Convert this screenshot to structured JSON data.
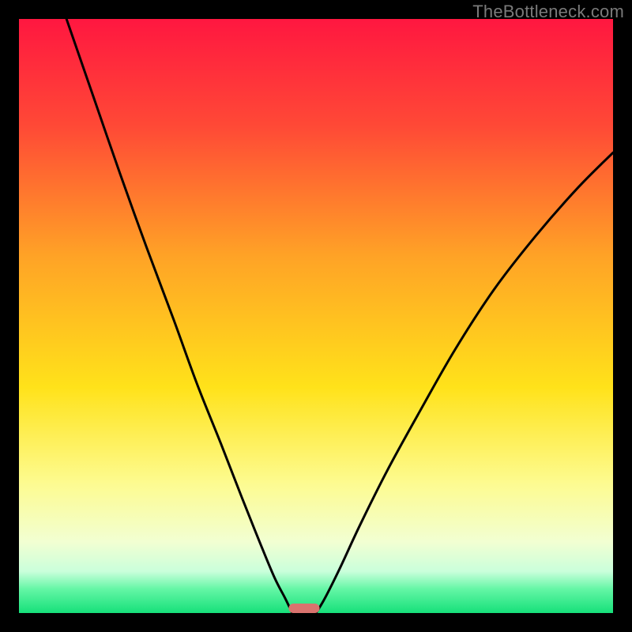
{
  "watermark": {
    "text": "TheBottleneck.com"
  },
  "chart_data": {
    "type": "line",
    "title": "",
    "xlabel": "",
    "ylabel": "",
    "xlim": [
      0,
      100
    ],
    "ylim": [
      0,
      100
    ],
    "grid": false,
    "legend": false,
    "background_gradient_stops": [
      {
        "offset": 0,
        "color": "#ff1740"
      },
      {
        "offset": 18,
        "color": "#ff4936"
      },
      {
        "offset": 40,
        "color": "#ffa326"
      },
      {
        "offset": 62,
        "color": "#ffe21a"
      },
      {
        "offset": 78,
        "color": "#fdfb8f"
      },
      {
        "offset": 88,
        "color": "#f2ffd2"
      },
      {
        "offset": 93,
        "color": "#caffdb"
      },
      {
        "offset": 96,
        "color": "#63f6a5"
      },
      {
        "offset": 100,
        "color": "#16e07a"
      }
    ],
    "series": [
      {
        "name": "left-branch",
        "x": [
          8.0,
          12.5,
          17.0,
          21.5,
          26.0,
          30.0,
          34.0,
          37.5,
          40.5,
          43.0,
          44.8,
          46.0
        ],
        "values": [
          100.0,
          87.0,
          74.0,
          61.5,
          49.5,
          38.5,
          28.5,
          19.5,
          12.0,
          6.0,
          2.5,
          0.0
        ]
      },
      {
        "name": "right-branch",
        "x": [
          50.0,
          51.5,
          54.0,
          57.5,
          62.0,
          67.5,
          73.5,
          80.0,
          87.0,
          94.0,
          100.0
        ],
        "values": [
          0.0,
          2.5,
          7.5,
          15.0,
          24.0,
          34.0,
          44.5,
          54.5,
          63.5,
          71.5,
          77.5
        ]
      }
    ],
    "marker": {
      "name": "ideal-marker",
      "x_center": 48.0,
      "x_half_width": 2.6,
      "y": 1.6,
      "color": "#d9736e",
      "note": "narrow rounded rectangle on baseline"
    }
  }
}
